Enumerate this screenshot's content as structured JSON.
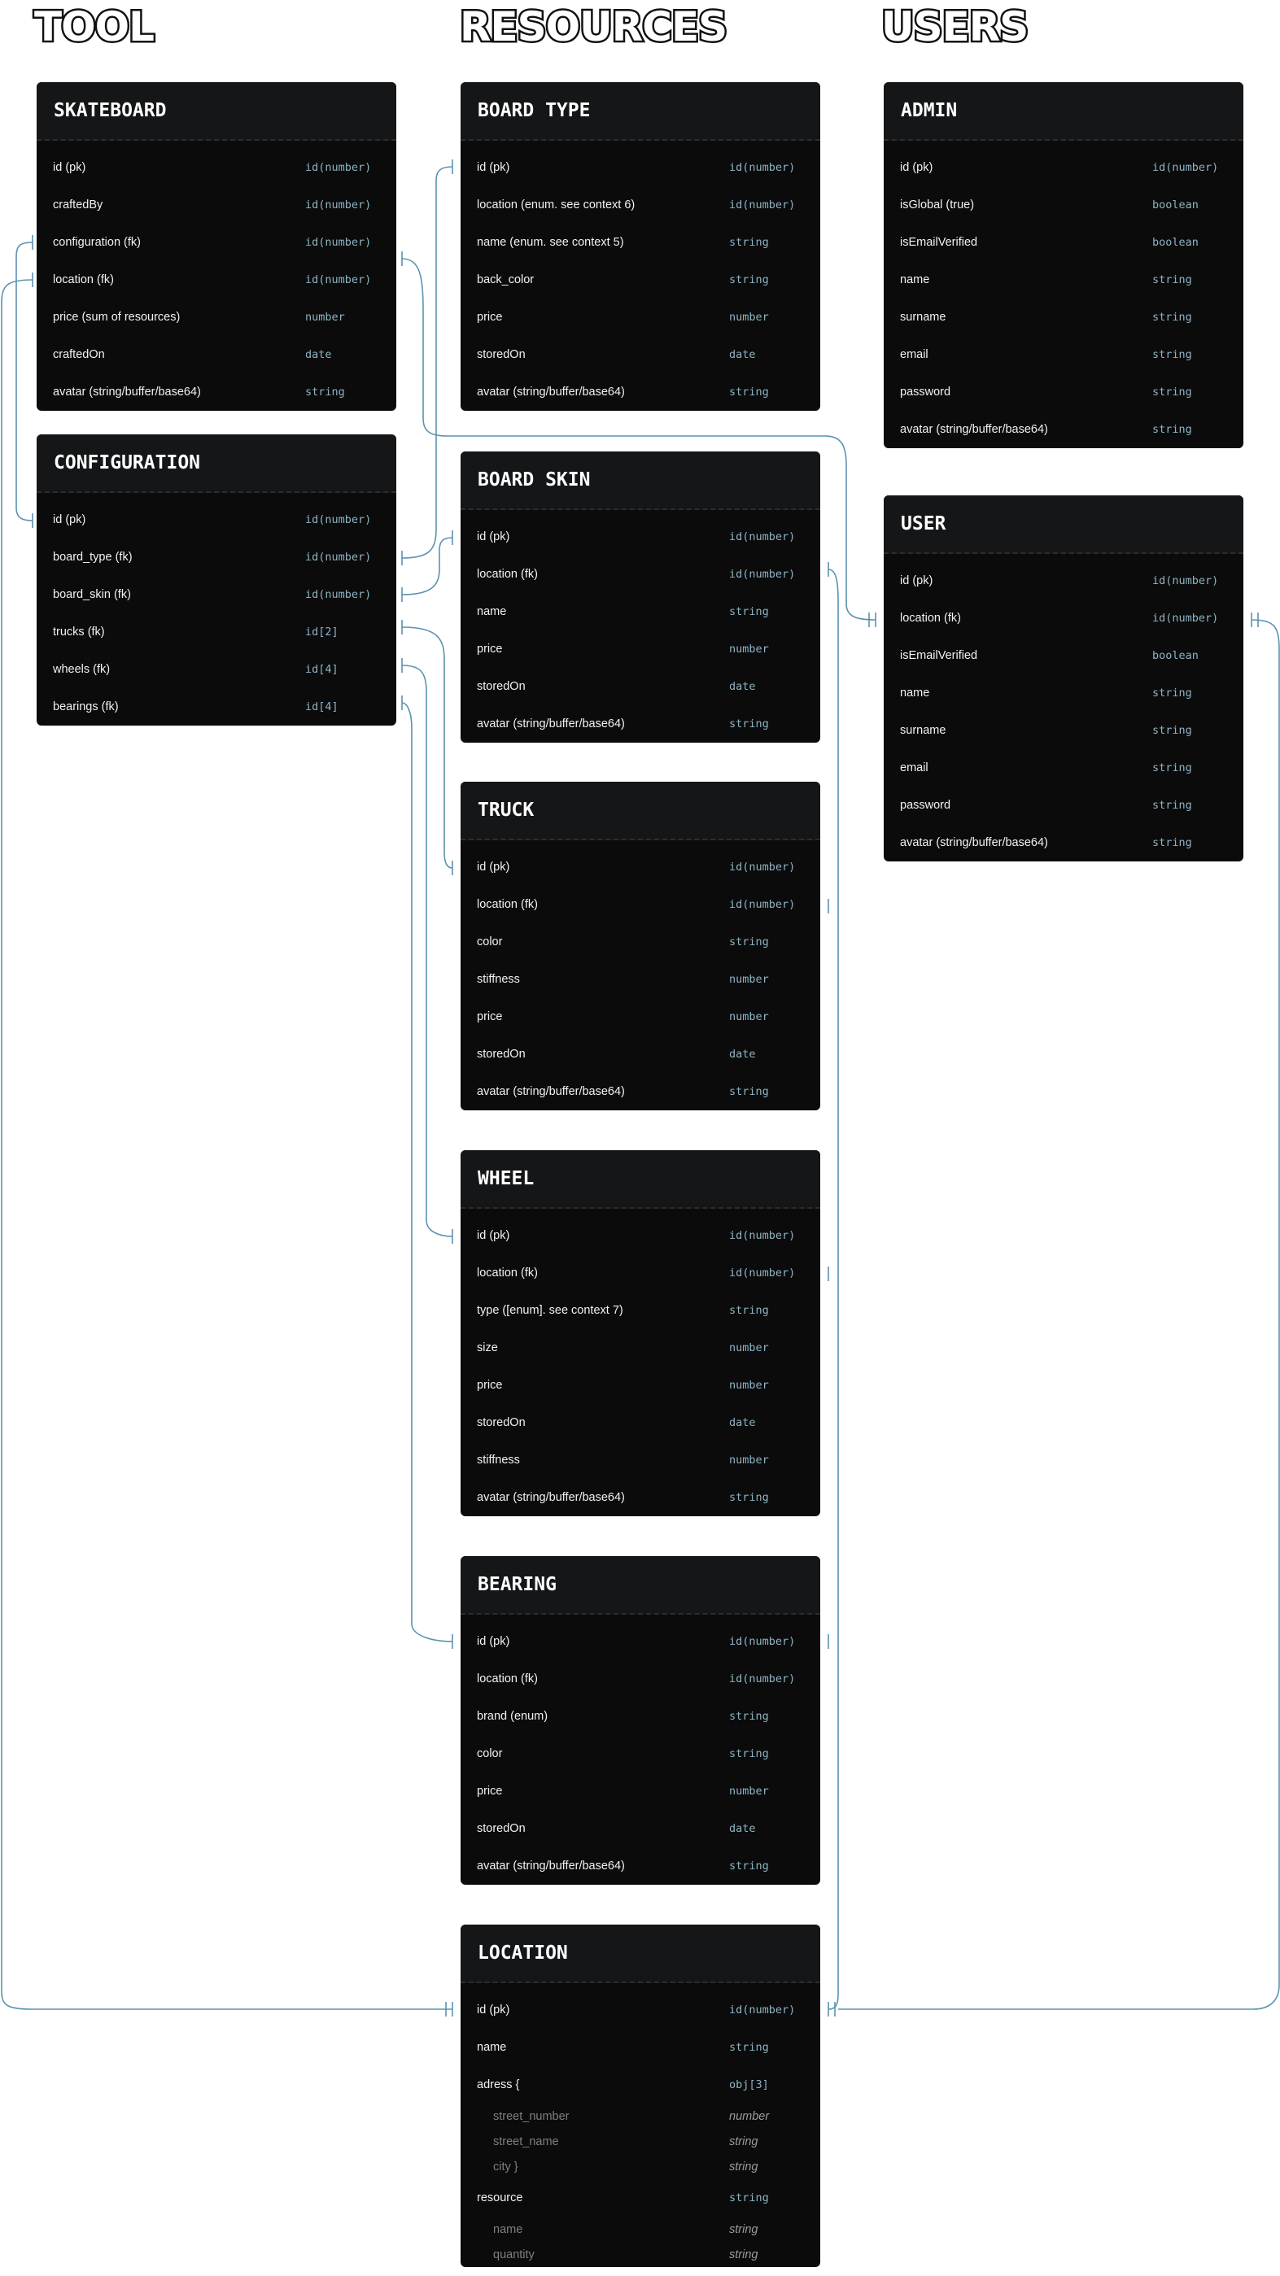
{
  "headings": {
    "tool": "TOOL",
    "resources": "RESOURCES",
    "users": "USERS"
  },
  "colors": {
    "connector": "#5a93b0",
    "card": "#0b0b0b",
    "card_header": "#151617",
    "type_text": "#8fb3c4"
  },
  "tables": [
    {
      "name": "SKATEBOARD",
      "fields": [
        {
          "name": "id (pk)",
          "type": "id(number)"
        },
        {
          "name": "craftedBy",
          "type": "id(number)"
        },
        {
          "name": "configuration (fk)",
          "type": "id(number)"
        },
        {
          "name": "location (fk)",
          "type": "id(number)"
        },
        {
          "name": "price (sum of resources)",
          "type": "number"
        },
        {
          "name": "craftedOn",
          "type": "date"
        },
        {
          "name": "avatar (string/buffer/base64)",
          "type": "string"
        }
      ]
    },
    {
      "name": "CONFIGURATION",
      "fields": [
        {
          "name": "id (pk)",
          "type": "id(number)"
        },
        {
          "name": "board_type (fk)",
          "type": "id(number)"
        },
        {
          "name": "board_skin (fk)",
          "type": "id(number)"
        },
        {
          "name": "trucks (fk)",
          "type": "id[2]"
        },
        {
          "name": "wheels (fk)",
          "type": "id[4]"
        },
        {
          "name": "bearings (fk)",
          "type": "id[4]"
        }
      ]
    },
    {
      "name": "BOARD TYPE",
      "fields": [
        {
          "name": "id (pk)",
          "type": "id(number)"
        },
        {
          "name": "location (enum. see context 6)",
          "type": "id(number)"
        },
        {
          "name": "name (enum. see context 5)",
          "type": "string"
        },
        {
          "name": "back_color",
          "type": "string"
        },
        {
          "name": "price",
          "type": "number"
        },
        {
          "name": "storedOn",
          "type": "date"
        },
        {
          "name": "avatar (string/buffer/base64)",
          "type": "string"
        }
      ]
    },
    {
      "name": "BOARD SKIN",
      "fields": [
        {
          "name": "id (pk)",
          "type": "id(number)"
        },
        {
          "name": "location (fk)",
          "type": "id(number)"
        },
        {
          "name": "name",
          "type": "string"
        },
        {
          "name": "price",
          "type": "number"
        },
        {
          "name": "storedOn",
          "type": "date"
        },
        {
          "name": "avatar (string/buffer/base64)",
          "type": "string"
        }
      ]
    },
    {
      "name": "TRUCK",
      "fields": [
        {
          "name": "id (pk)",
          "type": "id(number)"
        },
        {
          "name": "location (fk)",
          "type": "id(number)"
        },
        {
          "name": "color",
          "type": "string"
        },
        {
          "name": "stiffness",
          "type": "number"
        },
        {
          "name": "price",
          "type": "number"
        },
        {
          "name": "storedOn",
          "type": "date"
        },
        {
          "name": "avatar (string/buffer/base64)",
          "type": "string"
        }
      ]
    },
    {
      "name": "WHEEL",
      "fields": [
        {
          "name": "id (pk)",
          "type": "id(number)"
        },
        {
          "name": "location (fk)",
          "type": "id(number)"
        },
        {
          "name": "type ([enum]. see context 7)",
          "type": "string"
        },
        {
          "name": "size",
          "type": "number"
        },
        {
          "name": "price",
          "type": "number"
        },
        {
          "name": "storedOn",
          "type": "date"
        },
        {
          "name": "stiffness",
          "type": "number"
        },
        {
          "name": "avatar (string/buffer/base64)",
          "type": "string"
        }
      ]
    },
    {
      "name": "BEARING",
      "fields": [
        {
          "name": "id (pk)",
          "type": "id(number)"
        },
        {
          "name": "location (fk)",
          "type": "id(number)"
        },
        {
          "name": "brand (enum)",
          "type": "string"
        },
        {
          "name": "color",
          "type": "string"
        },
        {
          "name": "price",
          "type": "number"
        },
        {
          "name": "storedOn",
          "type": "date"
        },
        {
          "name": "avatar (string/buffer/base64)",
          "type": "string"
        }
      ]
    },
    {
      "name": "LOCATION",
      "fields": [
        {
          "name": "id (pk)",
          "type": "id(number)"
        },
        {
          "name": "name",
          "type": "string"
        },
        {
          "name": "adress {",
          "type": "obj[3]"
        },
        {
          "name": "street_number",
          "type": "number",
          "sub": true
        },
        {
          "name": "street_name",
          "type": "string",
          "sub": true
        },
        {
          "name": "city }",
          "type": "string",
          "sub": true
        },
        {
          "name": "resource",
          "type": "string"
        },
        {
          "name": "name",
          "type": "string",
          "sub": true
        },
        {
          "name": "quantity",
          "type": "string",
          "sub": true
        }
      ]
    },
    {
      "name": "ADMIN",
      "fields": [
        {
          "name": "id (pk)",
          "type": "id(number)"
        },
        {
          "name": "isGlobal (true)",
          "type": "boolean"
        },
        {
          "name": "isEmailVerified",
          "type": "boolean"
        },
        {
          "name": "name",
          "type": "string"
        },
        {
          "name": "surname",
          "type": "string"
        },
        {
          "name": "email",
          "type": "string"
        },
        {
          "name": "password",
          "type": "string"
        },
        {
          "name": "avatar (string/buffer/base64)",
          "type": "string"
        }
      ]
    },
    {
      "name": "USER",
      "fields": [
        {
          "name": "id (pk)",
          "type": "id(number)"
        },
        {
          "name": "location (fk)",
          "type": "id(number)"
        },
        {
          "name": "isEmailVerified",
          "type": "boolean"
        },
        {
          "name": "name",
          "type": "string"
        },
        {
          "name": "surname",
          "type": "string"
        },
        {
          "name": "email",
          "type": "string"
        },
        {
          "name": "password",
          "type": "string"
        },
        {
          "name": "avatar (string/buffer/base64)",
          "type": "string"
        }
      ]
    }
  ]
}
